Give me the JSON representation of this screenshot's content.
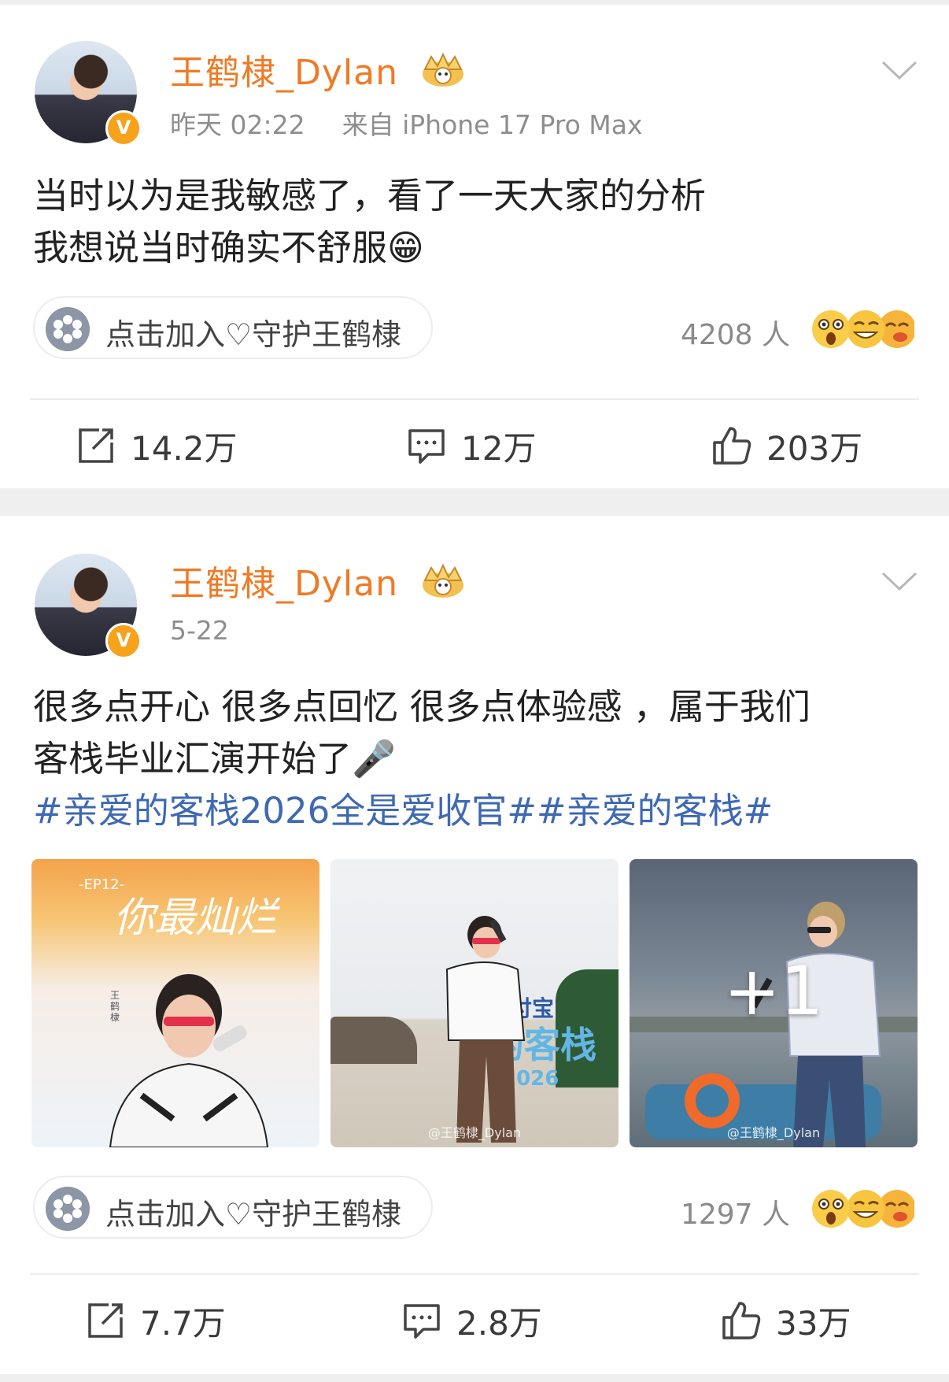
{
  "posts": [
    {
      "author": "王鹤棣_Dylan",
      "time": "昨天 02:22",
      "source": "来自 iPhone 17 Pro Max",
      "text_line1": "当时以为是我敏感了，看了一天大家的分析",
      "text_line2": "我想说当时确实不舒服😁",
      "group_label": "点击加入♡守护王鹤棣",
      "group_count": "4208 人",
      "repost": "14.2万",
      "comment": "12万",
      "like": "203万"
    },
    {
      "author": "王鹤棣_Dylan",
      "time": "5-22",
      "text_line1": "很多点开心 很多点回忆 很多点体验感 ，属于我们",
      "text_line2": "客栈毕业汇演开始了🎤",
      "hashtags": "#亲爱的客栈2026全是爱收官##亲爱的客栈#",
      "images": [
        {
          "title_art": "你最灿烂",
          "ep": "-EP12-",
          "side_text": "王鹤棣"
        },
        {
          "sign": "支付宝",
          "banner": "的客栈",
          "year": "2026",
          "watermark": "@王鹤棣_Dylan"
        },
        {
          "overlay": "+1",
          "watermark": "@王鹤棣_Dylan"
        }
      ],
      "group_label": "点击加入♡守护王鹤棣",
      "group_count": "1297 人",
      "repost": "7.7万",
      "comment": "2.8万",
      "like": "33万"
    }
  ],
  "colors": {
    "name": "#f07a25",
    "hashtag": "#3e69b3",
    "badge": "#f7a21b"
  },
  "icons": [
    "avatar",
    "v-badge-icon",
    "crown-icon",
    "chevron-down-icon",
    "group-icon",
    "emoji-reactions-icon",
    "repost-icon",
    "comment-icon",
    "like-icon"
  ]
}
